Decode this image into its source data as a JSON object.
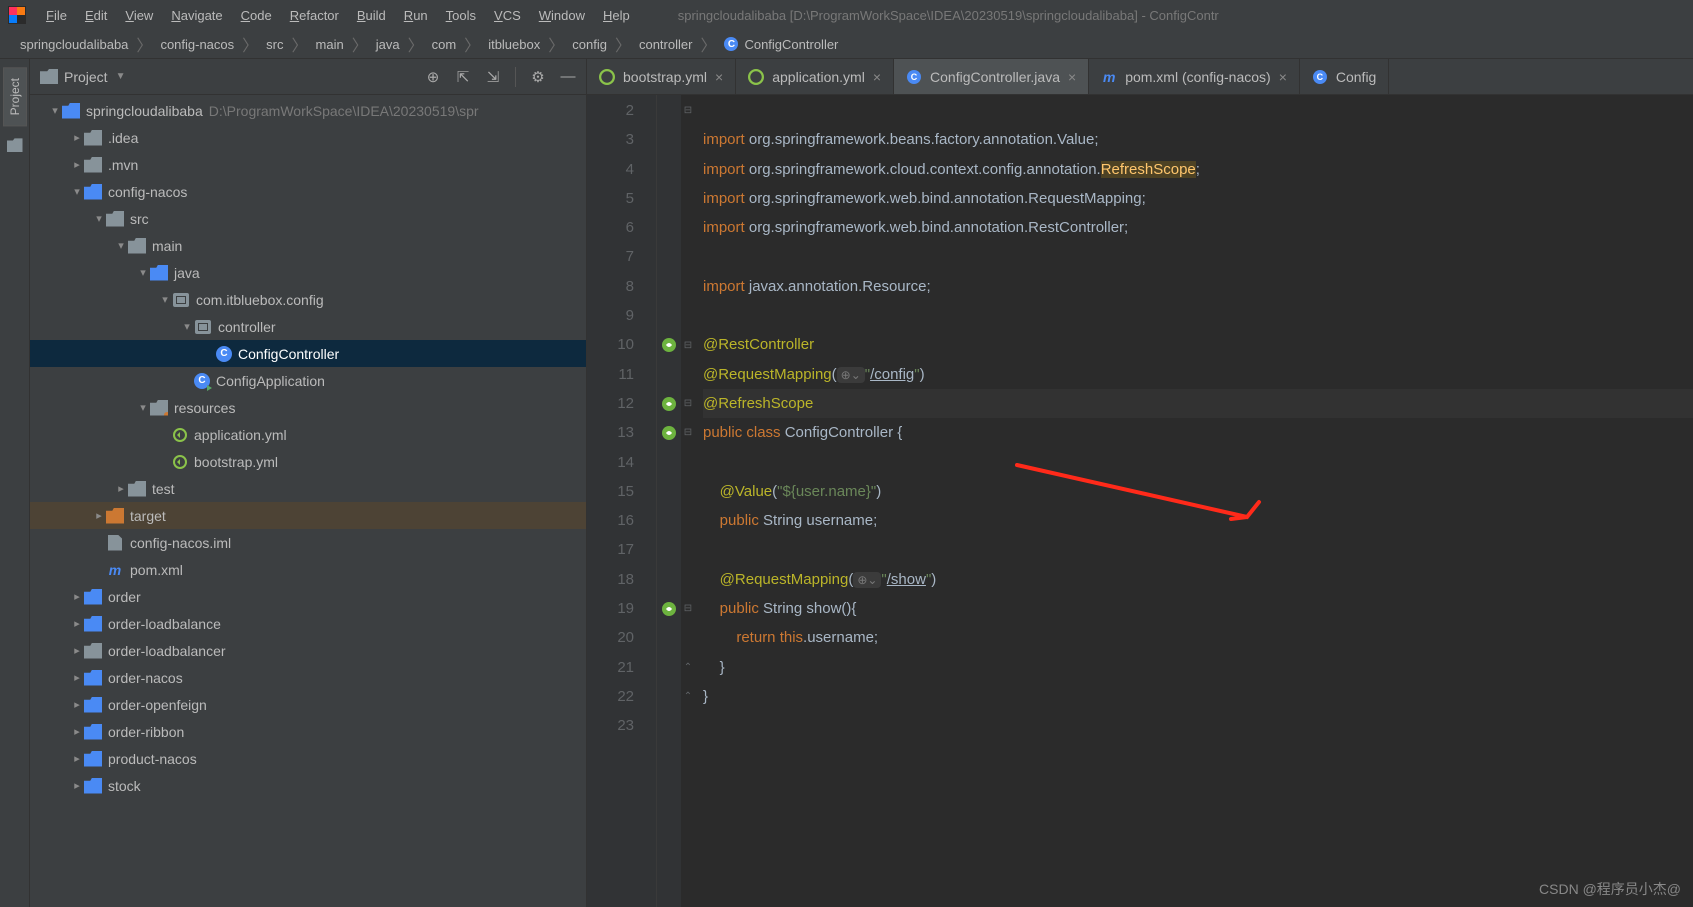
{
  "window_title": "springcloudalibaba [D:\\ProgramWorkSpace\\IDEA\\20230519\\springcloudalibaba] - ConfigContr",
  "menu": [
    "File",
    "Edit",
    "View",
    "Navigate",
    "Code",
    "Refactor",
    "Build",
    "Run",
    "Tools",
    "VCS",
    "Window",
    "Help"
  ],
  "breadcrumbs": [
    "springcloudalibaba",
    "config-nacos",
    "src",
    "main",
    "java",
    "com",
    "itbluebox",
    "config",
    "controller",
    "ConfigController"
  ],
  "panel": {
    "title": "Project",
    "tools": [
      "locate",
      "expand",
      "collapse",
      "settings",
      "hide"
    ]
  },
  "sidebar_tab": "Project",
  "tree": [
    {
      "d": 0,
      "exp": "v",
      "icon": "mod",
      "label": "springcloudalibaba",
      "hint": "D:\\ProgramWorkSpace\\IDEA\\20230519\\spr"
    },
    {
      "d": 1,
      "exp": ">",
      "icon": "dir",
      "label": ".idea"
    },
    {
      "d": 1,
      "exp": ">",
      "icon": "dir",
      "label": ".mvn"
    },
    {
      "d": 1,
      "exp": "v",
      "icon": "mod",
      "label": "config-nacos"
    },
    {
      "d": 2,
      "exp": "v",
      "icon": "dir",
      "label": "src"
    },
    {
      "d": 3,
      "exp": "v",
      "icon": "dir",
      "label": "main"
    },
    {
      "d": 4,
      "exp": "v",
      "icon": "src",
      "label": "java"
    },
    {
      "d": 5,
      "exp": "v",
      "icon": "pkg",
      "label": "com.itbluebox.config"
    },
    {
      "d": 6,
      "exp": "v",
      "icon": "pkg",
      "label": "controller"
    },
    {
      "d": 7,
      "exp": "",
      "icon": "class",
      "label": "ConfigController",
      "sel": true
    },
    {
      "d": 6,
      "exp": "",
      "icon": "run",
      "label": "ConfigApplication"
    },
    {
      "d": 4,
      "exp": "v",
      "icon": "res",
      "label": "resources"
    },
    {
      "d": 5,
      "exp": "",
      "icon": "yml",
      "label": "application.yml"
    },
    {
      "d": 5,
      "exp": "",
      "icon": "yml",
      "label": "bootstrap.yml"
    },
    {
      "d": 3,
      "exp": ">",
      "icon": "dir",
      "label": "test"
    },
    {
      "d": 2,
      "exp": ">",
      "icon": "exc",
      "label": "target",
      "tgt": true
    },
    {
      "d": 2,
      "exp": "",
      "icon": "file",
      "label": "config-nacos.iml"
    },
    {
      "d": 2,
      "exp": "",
      "icon": "maven",
      "label": "pom.xml"
    },
    {
      "d": 1,
      "exp": ">",
      "icon": "mod",
      "label": "order"
    },
    {
      "d": 1,
      "exp": ">",
      "icon": "mod",
      "label": "order-loadbalance"
    },
    {
      "d": 1,
      "exp": ">",
      "icon": "dir",
      "label": "order-loadbalancer"
    },
    {
      "d": 1,
      "exp": ">",
      "icon": "mod",
      "label": "order-nacos"
    },
    {
      "d": 1,
      "exp": ">",
      "icon": "mod",
      "label": "order-openfeign"
    },
    {
      "d": 1,
      "exp": ">",
      "icon": "mod",
      "label": "order-ribbon"
    },
    {
      "d": 1,
      "exp": ">",
      "icon": "mod",
      "label": "product-nacos"
    },
    {
      "d": 1,
      "exp": ">",
      "icon": "mod",
      "label": "stock"
    }
  ],
  "tabs": [
    {
      "icon": "yml",
      "label": "bootstrap.yml",
      "active": false
    },
    {
      "icon": "yml",
      "label": "application.yml",
      "active": false
    },
    {
      "icon": "class",
      "label": "ConfigController.java",
      "active": true
    },
    {
      "icon": "maven",
      "label": "pom.xml (config-nacos)",
      "active": false
    },
    {
      "icon": "class",
      "label": "Config",
      "active": false,
      "partial": true
    }
  ],
  "line_start": 2,
  "line_end": 23,
  "gutter_marks": {
    "10": "bean",
    "12": "bean",
    "13": "bean",
    "19": "bean"
  },
  "folds": {
    "2": "-",
    "10": "-",
    "12": "-",
    "13": "-",
    "19": "-",
    "21": "^",
    "22": "^"
  },
  "code_lines": [
    {
      "n": 2,
      "html": ""
    },
    {
      "n": 3,
      "html": "<span class='kw'>import</span> org.springframework.beans.factory.annotation.Value;"
    },
    {
      "n": 4,
      "html": "<span class='kw'>import</span> org.springframework.cloud.context.config.annotation.<span class='hl-y'>RefreshScope</span>;"
    },
    {
      "n": 5,
      "html": "<span class='kw'>import</span> org.springframework.web.bind.annotation.RequestMapping;"
    },
    {
      "n": 6,
      "html": "<span class='kw'>import</span> org.springframework.web.bind.annotation.RestController;"
    },
    {
      "n": 7,
      "html": ""
    },
    {
      "n": 8,
      "html": "<span class='kw'>import</span> javax.annotation.Resource;"
    },
    {
      "n": 9,
      "html": ""
    },
    {
      "n": 10,
      "html": "<span class='ann'>@RestController</span>"
    },
    {
      "n": 11,
      "html": "<span class='ann'>@RequestMapping</span>(<span class='inlay'>⊕⌄</span><span class='str'>\"</span><span class='link str'>/config</span><span class='str'>\"</span>)"
    },
    {
      "n": 12,
      "html": "<span class='ann'>@RefreshScope</span>",
      "hl": true
    },
    {
      "n": 13,
      "html": "<span class='kw'>public class</span> ConfigController {"
    },
    {
      "n": 14,
      "html": ""
    },
    {
      "n": 15,
      "html": "    <span class='ann'>@Value</span>(<span class='str'>\"${user.name}\"</span>)"
    },
    {
      "n": 16,
      "html": "    <span class='kw'>public</span> String username;"
    },
    {
      "n": 17,
      "html": ""
    },
    {
      "n": 18,
      "html": "    <span class='ann'>@RequestMapping</span>(<span class='inlay'>⊕⌄</span><span class='str'>\"</span><span class='link str'>/show</span><span class='str'>\"</span>)"
    },
    {
      "n": 19,
      "html": "    <span class='kw'>public</span> String show(){"
    },
    {
      "n": 20,
      "html": "        <span class='kw'>return this</span>.username;"
    },
    {
      "n": 21,
      "html": "    }"
    },
    {
      "n": 22,
      "html": "}"
    },
    {
      "n": 23,
      "html": ""
    }
  ],
  "watermark": "CSDN @程序员小杰@"
}
